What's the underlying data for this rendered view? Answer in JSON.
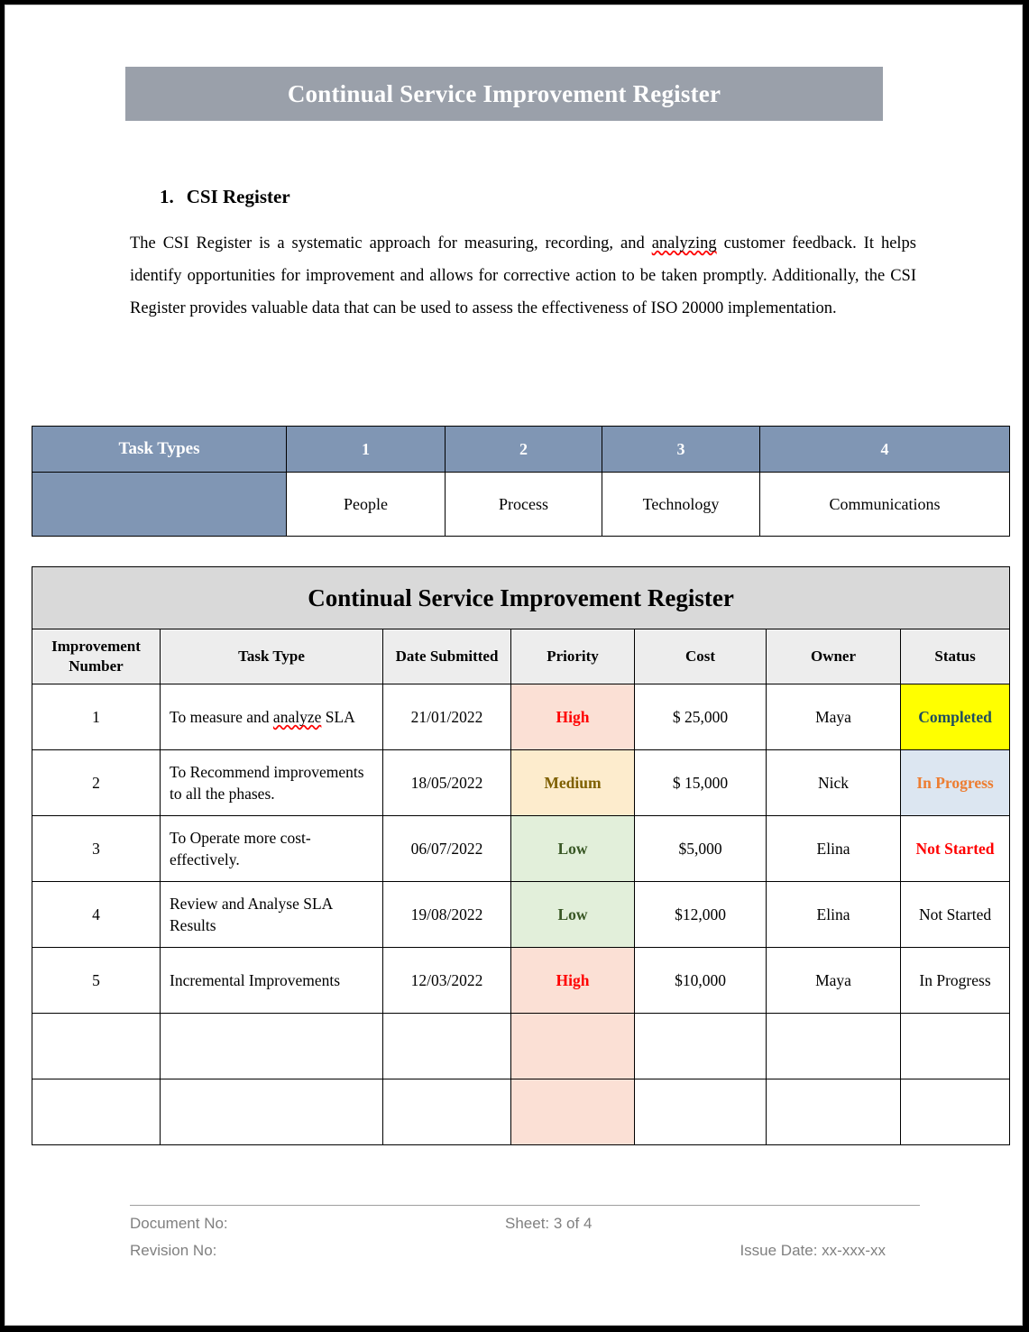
{
  "document": {
    "banner_title": "Continual Service Improvement Register",
    "section": {
      "number": "1.",
      "heading": "CSI Register"
    },
    "intro_paragraph": {
      "before_spell": "The CSI Register is a systematic approach for measuring, recording, and ",
      "spellchecked_word": "analyzing",
      "after_spell": " customer feedback. It helps identify opportunities for improvement and allows for corrective action to be taken promptly. Additionally, the CSI Register provides valuable data that can be used to assess the effectiveness of ISO 20000 implementation."
    }
  },
  "task_types_table": {
    "label": "Task Types",
    "numbers": [
      "1",
      "2",
      "3",
      "4"
    ],
    "values": [
      "People",
      "Process",
      "Technology",
      "Communications"
    ]
  },
  "register_table": {
    "title": "Continual Service Improvement Register",
    "columns": [
      "Improvement Number",
      "Task Type",
      "Date Submitted",
      "Priority",
      "Cost",
      "Owner",
      "Status"
    ],
    "rows": [
      {
        "number": "1",
        "task_type_pre": "To measure and ",
        "task_type_spell": "analyze",
        "task_type_post": " SLA",
        "date_submitted": "21/01/2022",
        "priority": "High",
        "cost": "$ 25,000",
        "owner": "Maya",
        "status": "Completed"
      },
      {
        "number": "2",
        "task_type": "To Recommend improvements to all the phases.",
        "date_submitted": "18/05/2022",
        "priority": "Medium",
        "cost": "$ 15,000",
        "owner": "Nick",
        "status": "In Progress"
      },
      {
        "number": "3",
        "task_type": "To Operate more cost-effectively.",
        "date_submitted": "06/07/2022",
        "priority": "Low",
        "cost": "$5,000",
        "owner": "Elina",
        "status": "Not Started"
      },
      {
        "number": "4",
        "task_type": "Review and Analyse SLA Results",
        "date_submitted": "19/08/2022",
        "priority": "Low",
        "cost": "$12,000",
        "owner": "Elina",
        "status": "Not Started"
      },
      {
        "number": "5",
        "task_type": "Incremental Improvements",
        "date_submitted": "12/03/2022",
        "priority": "High",
        "cost": "$10,000",
        "owner": "Maya",
        "status": "In Progress"
      }
    ],
    "empty_row_count": 2
  },
  "footer": {
    "document_no": "Document No:",
    "revision_no": "Revision No:",
    "sheet": "Sheet: 3 of 4",
    "issue_date": "Issue Date: xx-xxx-xx"
  },
  "colors": {
    "banner_gray": "#9aa0aa",
    "task_header_blue": "#8096b4",
    "title_row_gray": "#d9d9d9",
    "column_header_gray": "#ededed",
    "priority_high_bg": "#fbe0d5",
    "priority_high_fg": "#ff0000",
    "priority_medium_bg": "#fdeccd",
    "priority_medium_fg": "#7f6000",
    "priority_low_bg": "#e2efda",
    "priority_low_fg": "#375623",
    "status_completed_bg": "#ffff00",
    "status_completed_fg": "#1f4e5f",
    "status_inprogress_bg": "#dce6f1",
    "status_inprogress_fg": "#ed7d31",
    "status_notstarted_fg": "#ff0000",
    "footer_gray": "#808080",
    "spellcheck_red": "#ff0000"
  }
}
